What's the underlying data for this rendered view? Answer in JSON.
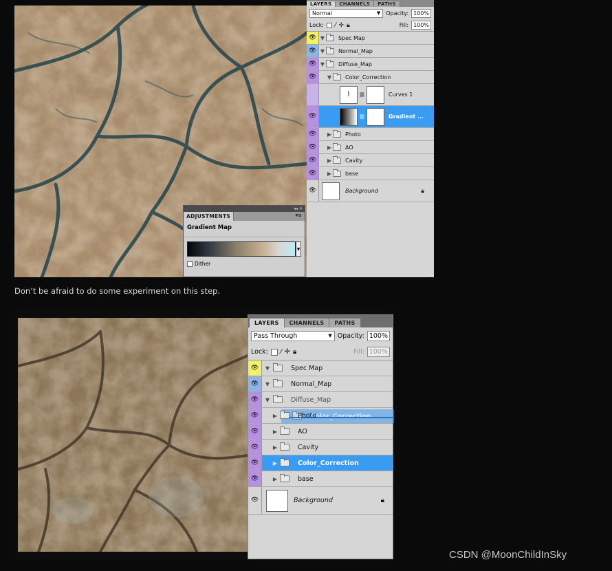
{
  "screenshot1": {
    "layers_panel": {
      "tabs": [
        "LAYERS",
        "CHANNELS",
        "PATHS"
      ],
      "blend_mode": "Normal",
      "opacity_label": "Opacity:",
      "opacity_value": "100%",
      "lock_label": "Lock:",
      "fill_label": "Fill:",
      "fill_value": "100%",
      "layers": [
        {
          "name": "Spec Map"
        },
        {
          "name": "Normal_Map"
        },
        {
          "name": "Diffuse_Map"
        },
        {
          "name": "Color_Correction"
        },
        {
          "name": "Curves 1"
        },
        {
          "name": "Gradient ..."
        },
        {
          "name": "Photo"
        },
        {
          "name": "AO"
        },
        {
          "name": "Cavity"
        },
        {
          "name": "base"
        },
        {
          "name": "Background"
        }
      ]
    },
    "adjustments_panel": {
      "tab": "ADJUSTMENTS",
      "title": "Gradient Map",
      "dither_label": "Dither"
    }
  },
  "caption": "Don’t  be afraid to do some experiment on this step.",
  "screenshot2": {
    "layers_panel": {
      "tabs": [
        "LAYERS",
        "CHANNELS",
        "PATHS"
      ],
      "blend_mode": "Pass Through",
      "opacity_label": "Opacity:",
      "opacity_value": "100%",
      "lock_label": "Lock:",
      "fill_label": "Fill:",
      "fill_value": "100%",
      "layers": [
        {
          "name": "Spec Map"
        },
        {
          "name": "Normal_Map"
        },
        {
          "name": "Diffuse_Map"
        },
        {
          "name": "Color_Correction"
        },
        {
          "name": "Photo"
        },
        {
          "name": "AO"
        },
        {
          "name": "Cavity"
        },
        {
          "name": "Color_Correction"
        },
        {
          "name": "base"
        },
        {
          "name": "Background"
        }
      ]
    }
  },
  "watermark": "CSDN @MoonChildInSky",
  "colors": {
    "selection_blue": "#3a9bf2",
    "eye_yellow": "#f3f06a",
    "eye_blue": "#8db5e6",
    "eye_purple": "#b790e3"
  }
}
